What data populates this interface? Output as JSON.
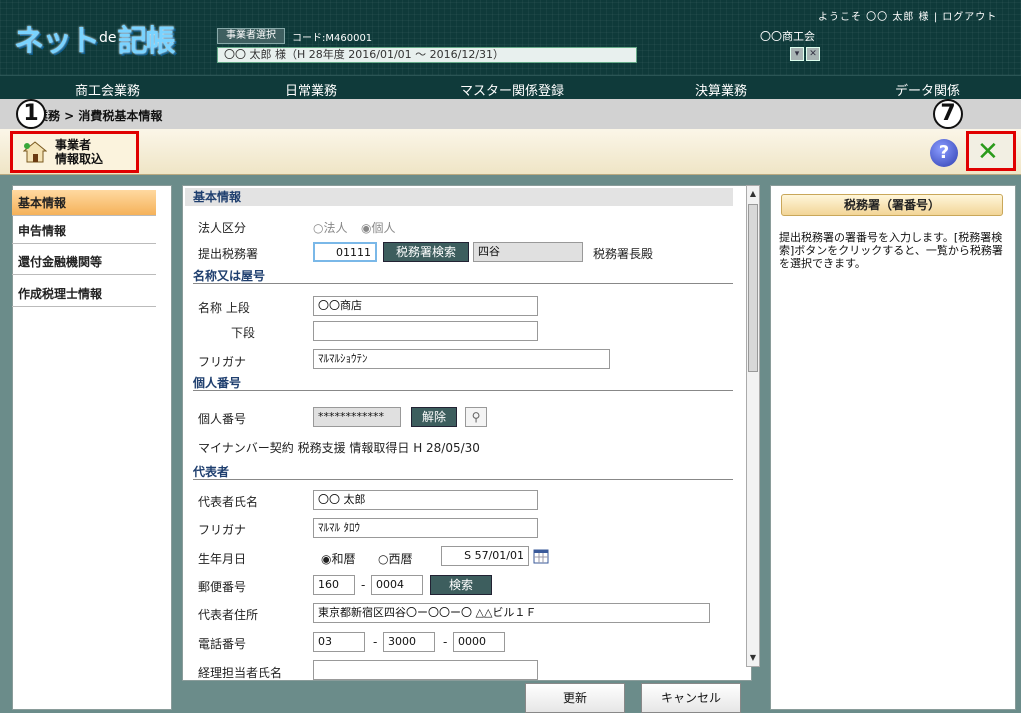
{
  "header": {
    "logo": "ネットde記帳",
    "logo_main_1": "ネット",
    "logo_de": "de",
    "logo_main_2": "記帳",
    "select_button": "事業者選択",
    "code": "コード:M460001",
    "user_info": "〇〇  太郎 様（H 28年度 2016/01/01 〜 2016/12/31）",
    "welcome": "ようこそ  〇〇  太郎 様 | ログアウト",
    "chamber": "〇〇商工会"
  },
  "menu": [
    "商工会業務",
    "日常業務",
    "マスター関係登録",
    "決算業務",
    "データ関係"
  ],
  "breadcrumb": "業務 > 消費税基本情報",
  "toolbar": {
    "import_label_1": "事業者",
    "import_label_2": "情報取込",
    "callout_1": "1",
    "callout_7": "7",
    "help": "?",
    "close": "✕"
  },
  "sidenav": [
    "基本情報",
    "申告情報",
    "還付金融機関等",
    "作成税理士情報"
  ],
  "form": {
    "section_basic": "基本情報",
    "corp_type_label": "法人区分",
    "corp_options": [
      "○法人",
      "◉個人"
    ],
    "tax_office_label": "提出税務署",
    "tax_office_code": "01111",
    "tax_office_search": "税務署検索",
    "tax_office_name": "四谷",
    "tax_office_chief": "税務署長殿",
    "section_name": "名称又は屋号",
    "name_upper_label": "名称  上段",
    "name_upper_value": "〇〇商店",
    "name_lower_label": "下段",
    "name_lower_value": "",
    "furigana_label": "フリガナ",
    "furigana_value": "ﾏﾙﾏﾙｼｮｳﾃﾝ",
    "section_personal": "個人番号",
    "personal_no_label": "個人番号",
    "personal_no_value": "************",
    "release_button": "解除",
    "mynumber_info": "マイナンバー契約  税務支援    情報取得日  H 28/05/30",
    "section_rep": "代表者",
    "rep_name_label": "代表者氏名",
    "rep_name_value": "〇〇  太郎",
    "rep_furigana_label": "フリガナ",
    "rep_furigana_value": "ﾏﾙﾏﾙ ﾀﾛｳ",
    "birth_label": "生年月日",
    "birth_options": [
      "◉和暦",
      "○西暦"
    ],
    "birth_value": "S 57/01/01",
    "postal_label": "郵便番号",
    "postal_1": "160",
    "postal_sep": "-",
    "postal_2": "0004",
    "search_button": "検索",
    "address_label": "代表者住所",
    "address_value": "東京都新宿区四谷〇ー〇〇ー〇  △△ビル１Ｆ",
    "phone_label": "電話番号",
    "phone_1": "03",
    "phone_2": "3000",
    "phone_3": "0000",
    "accountant_label": "経理担当者氏名",
    "accountant_value": ""
  },
  "footer": {
    "update": "更新",
    "cancel": "キャンセル"
  },
  "help_panel": {
    "title": "税務署（署番号）",
    "text": "提出税務署の署番号を入力します。[税務署検索]ボタンをクリックすると、一覧から税務署を選択できます。"
  }
}
